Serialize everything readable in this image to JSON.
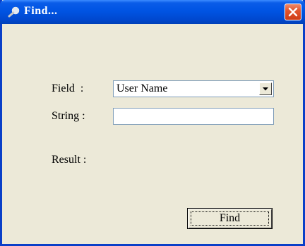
{
  "window": {
    "title": "Find...",
    "title_icon": "magnifier-icon",
    "close_icon": "close-icon"
  },
  "form": {
    "field_label": "Field  :",
    "field_value": "User Name",
    "string_label": "String :",
    "string_value": "",
    "result_label": "Result :"
  },
  "buttons": {
    "find_label": "Find"
  },
  "colors": {
    "titlebar": "#0054e3",
    "window_bg": "#ece9d8",
    "close": "#e2552e"
  }
}
